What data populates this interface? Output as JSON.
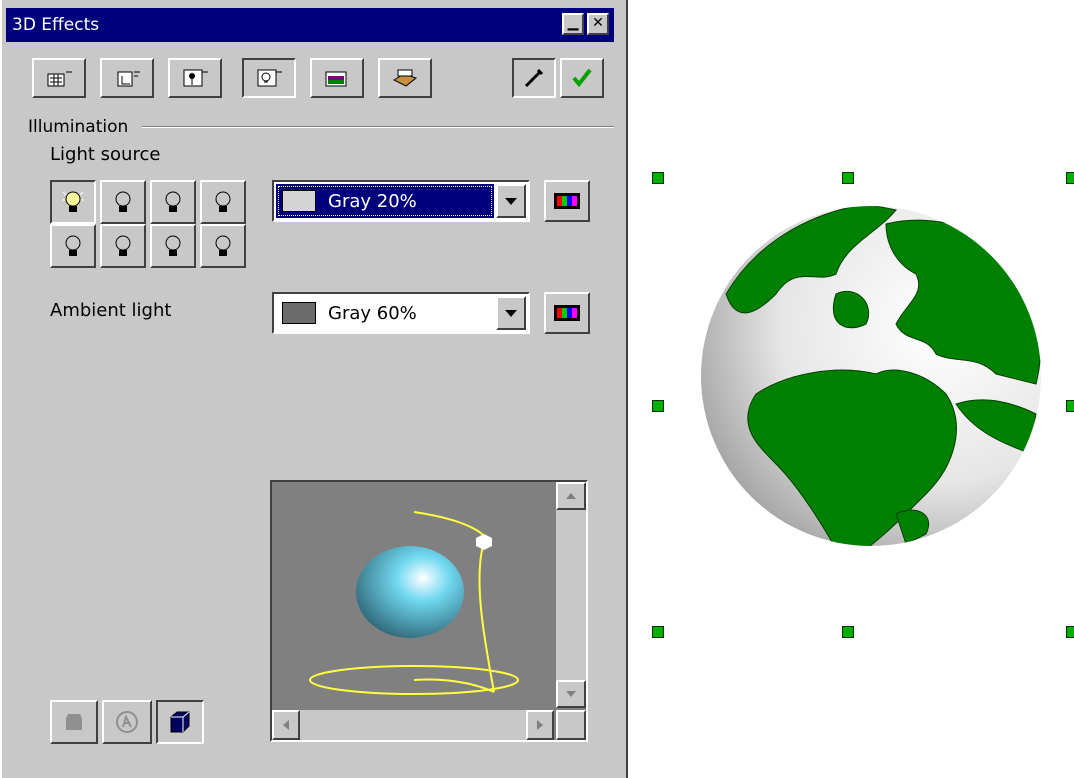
{
  "window": {
    "title": "3D Effects",
    "minimize_glyph": "▁",
    "close_glyph": "✕"
  },
  "tabs": [
    {
      "name": "geometry-tab",
      "icon": "geometry-icon"
    },
    {
      "name": "shading-tab",
      "icon": "shading-icon"
    },
    {
      "name": "camera-tab",
      "icon": "camera-icon"
    },
    {
      "name": "illumination-tab",
      "icon": "lightbulb-icon",
      "selected": true
    },
    {
      "name": "textures-tab",
      "icon": "textures-icon"
    },
    {
      "name": "material-tab",
      "icon": "material-icon"
    }
  ],
  "actions": {
    "pipette_icon": "pipette-icon",
    "assign_icon": "checkmark-icon"
  },
  "illumination": {
    "section_label": "Illumination",
    "light_source_label": "Light source",
    "light_source_value": "Gray 20%",
    "light_source_color": "#d4d4d4",
    "ambient_label": "Ambient light",
    "ambient_value": "Gray 60%",
    "ambient_color": "#6b6b6b"
  },
  "preview": {
    "sphere_color": "#70d8f0",
    "light_path_color": "#ffff40",
    "background": "#808080"
  },
  "colors": {
    "titlebar": "#00007c",
    "dialog_bg": "#c8c8c8",
    "globe_land": "#008000",
    "handle": "#00b000"
  }
}
